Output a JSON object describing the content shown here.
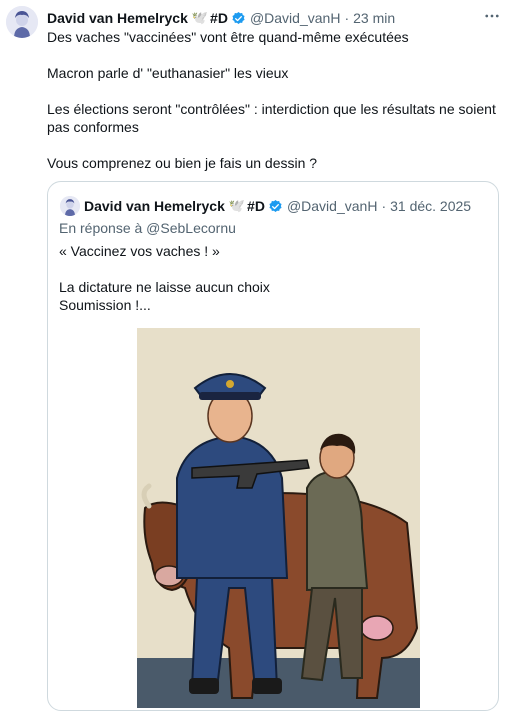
{
  "post": {
    "author_name": "David van Hemelryck",
    "author_emoji": "🕊️",
    "author_tag": "#D",
    "handle": "@David_vanH",
    "separator": "·",
    "time": "23 min",
    "icons": {
      "avatar": "avatar-illustration",
      "verified": "verified-badge-icon",
      "more": "more-options-icon"
    },
    "lines": [
      "Des vaches \"vaccinées\" vont être quand-même exécutées",
      "Macron parle d' \"euthanasier\" les vieux",
      "Les élections seront \"contrôlées\" : interdiction que les résultats ne soient pas conformes",
      "Vous comprenez ou bien je fais un dessin ?"
    ]
  },
  "quote": {
    "author_name": "David van Hemelryck",
    "author_emoji": "🕊️",
    "author_tag": "#D",
    "handle": "@David_vanH",
    "separator": "·",
    "date": "31 déc. 2025",
    "reply_to": "En réponse à @SebLecornu",
    "lines": [
      "« Vaccinez vos vaches ! »",
      "La dictature ne laisse aucun choix",
      "Soumission !..."
    ],
    "image": "cartoon-officer-with-rifle-holding-cow-and-man"
  },
  "colors": {
    "text": "#0f1419",
    "muted": "#536471",
    "verified": "#1d9bf0",
    "border": "#cfd9de"
  }
}
